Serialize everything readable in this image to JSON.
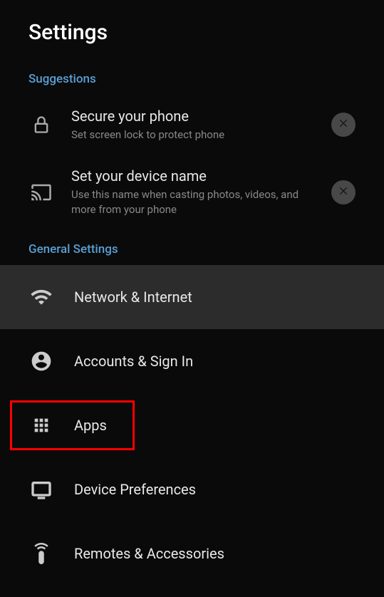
{
  "header": {
    "title": "Settings"
  },
  "sections": {
    "suggestions": {
      "label": "Suggestions",
      "items": [
        {
          "title": "Secure your phone",
          "subtitle": "Set screen lock to protect phone"
        },
        {
          "title": "Set your device name",
          "subtitle": "Use this name when casting photos, videos, and more from your phone"
        }
      ]
    },
    "general": {
      "label": "General Settings",
      "items": [
        {
          "label": "Network & Internet"
        },
        {
          "label": "Accounts & Sign In"
        },
        {
          "label": "Apps"
        },
        {
          "label": "Device Preferences"
        },
        {
          "label": "Remotes & Accessories"
        }
      ]
    }
  }
}
